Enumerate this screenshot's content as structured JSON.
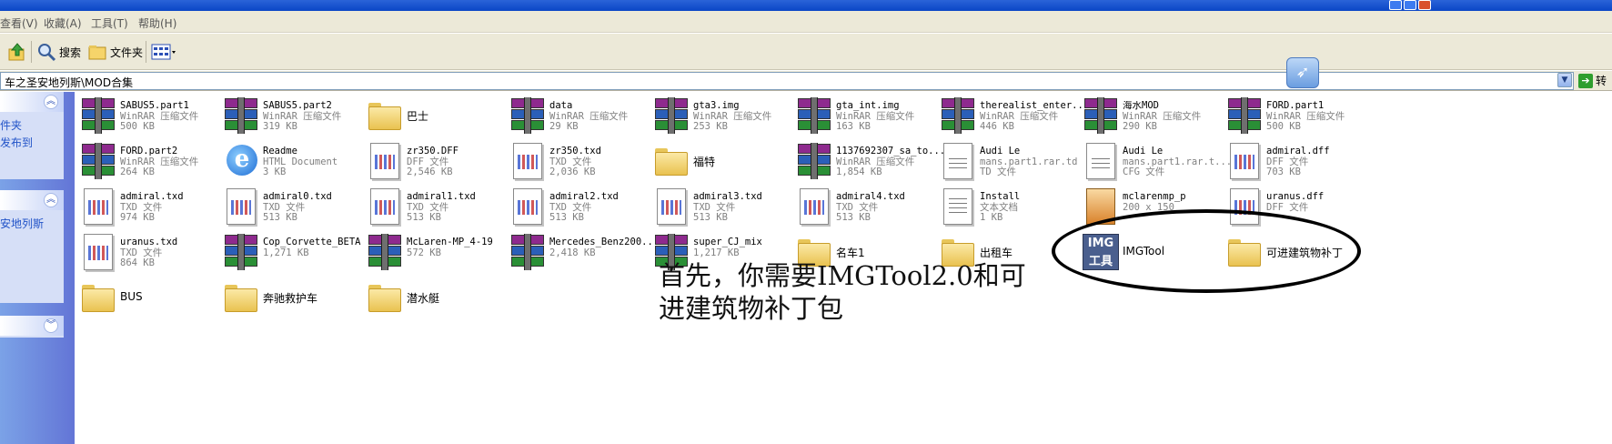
{
  "menu": [
    "查看(V)",
    "收藏(A)",
    "工具(T)",
    "帮助(H)"
  ],
  "toolbar": {
    "search_label": "搜索",
    "folders_label": "文件夹"
  },
  "address": {
    "path": "车之圣安地列斯\\MOD合集",
    "go_label": "转"
  },
  "leftpane": {
    "panel1_links": [
      "件夹",
      "发布到"
    ],
    "panel2_links": [
      "安地列斯"
    ]
  },
  "files": [
    {
      "name": "SABUS5.part1",
      "type": "WinRAR 压缩文件",
      "size": "500 KB",
      "icon": "rar-icon"
    },
    {
      "name": "SABUS5.part2",
      "type": "WinRAR 压缩文件",
      "size": "319 KB",
      "icon": "rar-icon"
    },
    {
      "name": "巴士",
      "icon": "folder-icon"
    },
    {
      "name": "data",
      "type": "WinRAR 压缩文件",
      "size": "29 KB",
      "icon": "rar-icon"
    },
    {
      "name": "gta3.img",
      "type": "WinRAR 压缩文件",
      "size": "253 KB",
      "icon": "rar-icon"
    },
    {
      "name": "gta_int.img",
      "type": "WinRAR 压缩文件",
      "size": "163 KB",
      "icon": "rar-icon"
    },
    {
      "name": "therealist_enter...",
      "type": "WinRAR 压缩文件",
      "size": "446 KB",
      "icon": "rar-icon"
    },
    {
      "name": "海水MOD",
      "type": "WinRAR 压缩文件",
      "size": "290 KB",
      "icon": "rar-icon"
    },
    {
      "name": "FORD.part1",
      "type": "WinRAR 压缩文件",
      "size": "500 KB",
      "icon": "rar-icon"
    },
    {
      "name": "FORD.part2",
      "type": "WinRAR 压缩文件",
      "size": "264 KB",
      "icon": "rar-icon"
    },
    {
      "name": "Readme",
      "type": "HTML Document",
      "size": "3 KB",
      "icon": "ie-icon"
    },
    {
      "name": "zr350.DFF",
      "type": "DFF 文件",
      "size": "2,546 KB",
      "icon": "txd-icon"
    },
    {
      "name": "zr350.txd",
      "type": "TXD 文件",
      "size": "2,036 KB",
      "icon": "txd-icon"
    },
    {
      "name": "福特",
      "icon": "folder-icon"
    },
    {
      "name": "1137692307_sa_to...",
      "type": "WinRAR 压缩文件",
      "size": "1,854 KB",
      "icon": "rar-icon"
    },
    {
      "name": "Audi Le",
      "type": "mans.part1.rar.td",
      "size": "TD 文件",
      "icon": "document-icon"
    },
    {
      "name": "Audi Le",
      "type": "mans.part1.rar.t...",
      "size": "CFG 文件",
      "icon": "document-icon"
    },
    {
      "name": "admiral.dff",
      "type": "DFF 文件",
      "size": "703 KB",
      "icon": "txd-icon"
    },
    {
      "name": "admiral.txd",
      "type": "TXD 文件",
      "size": "974 KB",
      "icon": "txd-icon"
    },
    {
      "name": "admiral0.txd",
      "type": "TXD 文件",
      "size": "513 KB",
      "icon": "txd-icon"
    },
    {
      "name": "admiral1.txd",
      "type": "TXD 文件",
      "size": "513 KB",
      "icon": "txd-icon"
    },
    {
      "name": "admiral2.txd",
      "type": "TXD 文件",
      "size": "513 KB",
      "icon": "txd-icon"
    },
    {
      "name": "admiral3.txd",
      "type": "TXD 文件",
      "size": "513 KB",
      "icon": "txd-icon"
    },
    {
      "name": "admiral4.txd",
      "type": "TXD 文件",
      "size": "513 KB",
      "icon": "txd-icon"
    },
    {
      "name": "Install",
      "type": "文本文档",
      "size": "1 KB",
      "icon": "text-document-icon"
    },
    {
      "name": "mclarenmp_p",
      "type": "200 x 150",
      "size": "",
      "icon": "image-icon"
    },
    {
      "name": "uranus.dff",
      "type": "DFF 文件",
      "size": "",
      "icon": "txd-icon"
    },
    {
      "name": "uranus.txd",
      "type": "TXD 文件",
      "size": "864 KB",
      "icon": "txd-icon"
    },
    {
      "name": "Cop_Corvette_BETA",
      "type": "1,271 KB",
      "size": "",
      "icon": "rar-icon"
    },
    {
      "name": "McLaren-MP_4-19",
      "type": "572 KB",
      "size": "",
      "icon": "rar-icon"
    },
    {
      "name": "Mercedes_Benz200...",
      "type": "2,418 KB",
      "size": "",
      "icon": "rar-icon"
    },
    {
      "name": "super_CJ_mix",
      "type": "1,217 KB",
      "size": "",
      "icon": "rar-icon"
    },
    {
      "name": "名车1",
      "icon": "folder-icon"
    },
    {
      "name": "出租车",
      "icon": "folder-icon"
    },
    {
      "name": "IMGTool",
      "icon": "imgtool-icon",
      "badge": "IMG 工具"
    },
    {
      "name": "可进建筑物补丁",
      "icon": "folder-icon"
    },
    {
      "name": "BUS",
      "icon": "folder-icon"
    },
    {
      "name": "奔驰救护车",
      "icon": "folder-icon"
    },
    {
      "name": "潜水艇",
      "icon": "folder-icon"
    }
  ],
  "annotation": {
    "line1": "首先，你需要IMGTool2.0和可",
    "line2": "进建筑物补丁包"
  },
  "colors": {
    "accent": "#0a46c6",
    "link": "#2153c8",
    "meta": "#808080"
  }
}
